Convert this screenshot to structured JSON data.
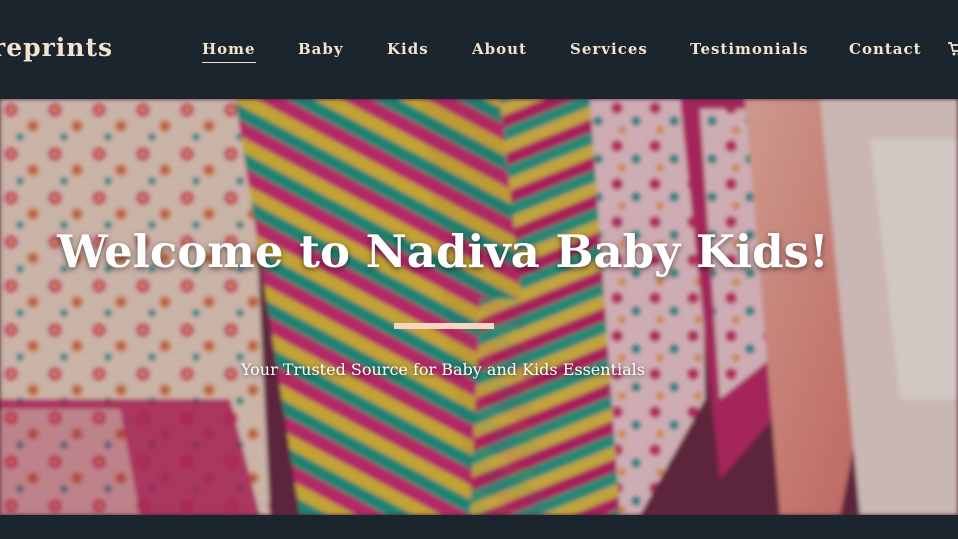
{
  "brand": {
    "logo_text": "Ereprints"
  },
  "nav": {
    "items": [
      {
        "label": "Home",
        "active": true
      },
      {
        "label": "Baby",
        "active": false
      },
      {
        "label": "Kids",
        "active": false
      },
      {
        "label": "About",
        "active": false
      },
      {
        "label": "Services",
        "active": false
      },
      {
        "label": "Testimonials",
        "active": false
      },
      {
        "label": "Contact",
        "active": false
      }
    ],
    "cart_icon": "shopping-cart-icon"
  },
  "hero": {
    "title": "Welcome to Nadiva Baby Kids!",
    "subtitle": "Your Trusted Source for Baby and Kids Essentials"
  },
  "colors": {
    "header_bg": "#1b252d",
    "nav_text": "#f3e3cf",
    "divider": "#f6d6c2",
    "hero_text": "#ffffff"
  }
}
